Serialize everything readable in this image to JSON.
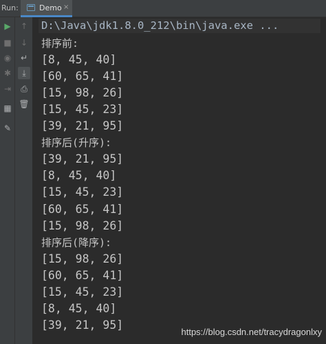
{
  "header": {
    "run_label": "Run:",
    "tab_label": "Demo",
    "tab_close": "×"
  },
  "toolbar": {
    "left": [
      {
        "name": "run-icon",
        "glyph": "▶",
        "color": "#59a869"
      },
      {
        "name": "stop-icon",
        "glyph": "■",
        "color": "#6e6e6e"
      },
      {
        "name": "camera-icon",
        "glyph": "◉",
        "color": "#6e6e6e"
      },
      {
        "name": "debug-bug-icon",
        "glyph": "✱",
        "color": "#6e6e6e"
      },
      {
        "name": "exit-icon",
        "glyph": "⇥",
        "color": "#6e6e6e"
      },
      {
        "name": "layout-icon",
        "glyph": "▦",
        "color": "#afb1b3"
      },
      {
        "name": "pin-icon",
        "glyph": "✎",
        "color": "#afb1b3"
      }
    ],
    "mid": [
      {
        "name": "up-arrow-icon",
        "glyph": "↑",
        "color": "#6e6e6e"
      },
      {
        "name": "down-arrow-icon",
        "glyph": "↓",
        "color": "#6e6e6e"
      },
      {
        "name": "soft-wrap-icon",
        "glyph": "↵",
        "color": "#afb1b3"
      },
      {
        "name": "scroll-to-end-icon",
        "glyph": "⤓",
        "color": "#afb1b3"
      },
      {
        "name": "print-icon",
        "glyph": "⎙",
        "color": "#afb1b3"
      },
      {
        "name": "trash-icon",
        "glyph": "🗑",
        "color": "#afb1b3"
      }
    ]
  },
  "console": {
    "command": "D:\\Java\\jdk1.8.0_212\\bin\\java.exe ...",
    "lines": [
      "排序前:",
      "[8, 45, 40]",
      "[60, 65, 41]",
      "[15, 98, 26]",
      "[15, 45, 23]",
      "[39, 21, 95]",
      "排序后(升序):",
      "[39, 21, 95]",
      "[8, 45, 40]",
      "[15, 45, 23]",
      "[60, 65, 41]",
      "[15, 98, 26]",
      "排序后(降序):",
      "[15, 98, 26]",
      "[60, 65, 41]",
      "[15, 45, 23]",
      "[8, 45, 40]",
      "[39, 21, 95]"
    ]
  },
  "watermark": "https://blog.csdn.net/tracydragonlxy"
}
